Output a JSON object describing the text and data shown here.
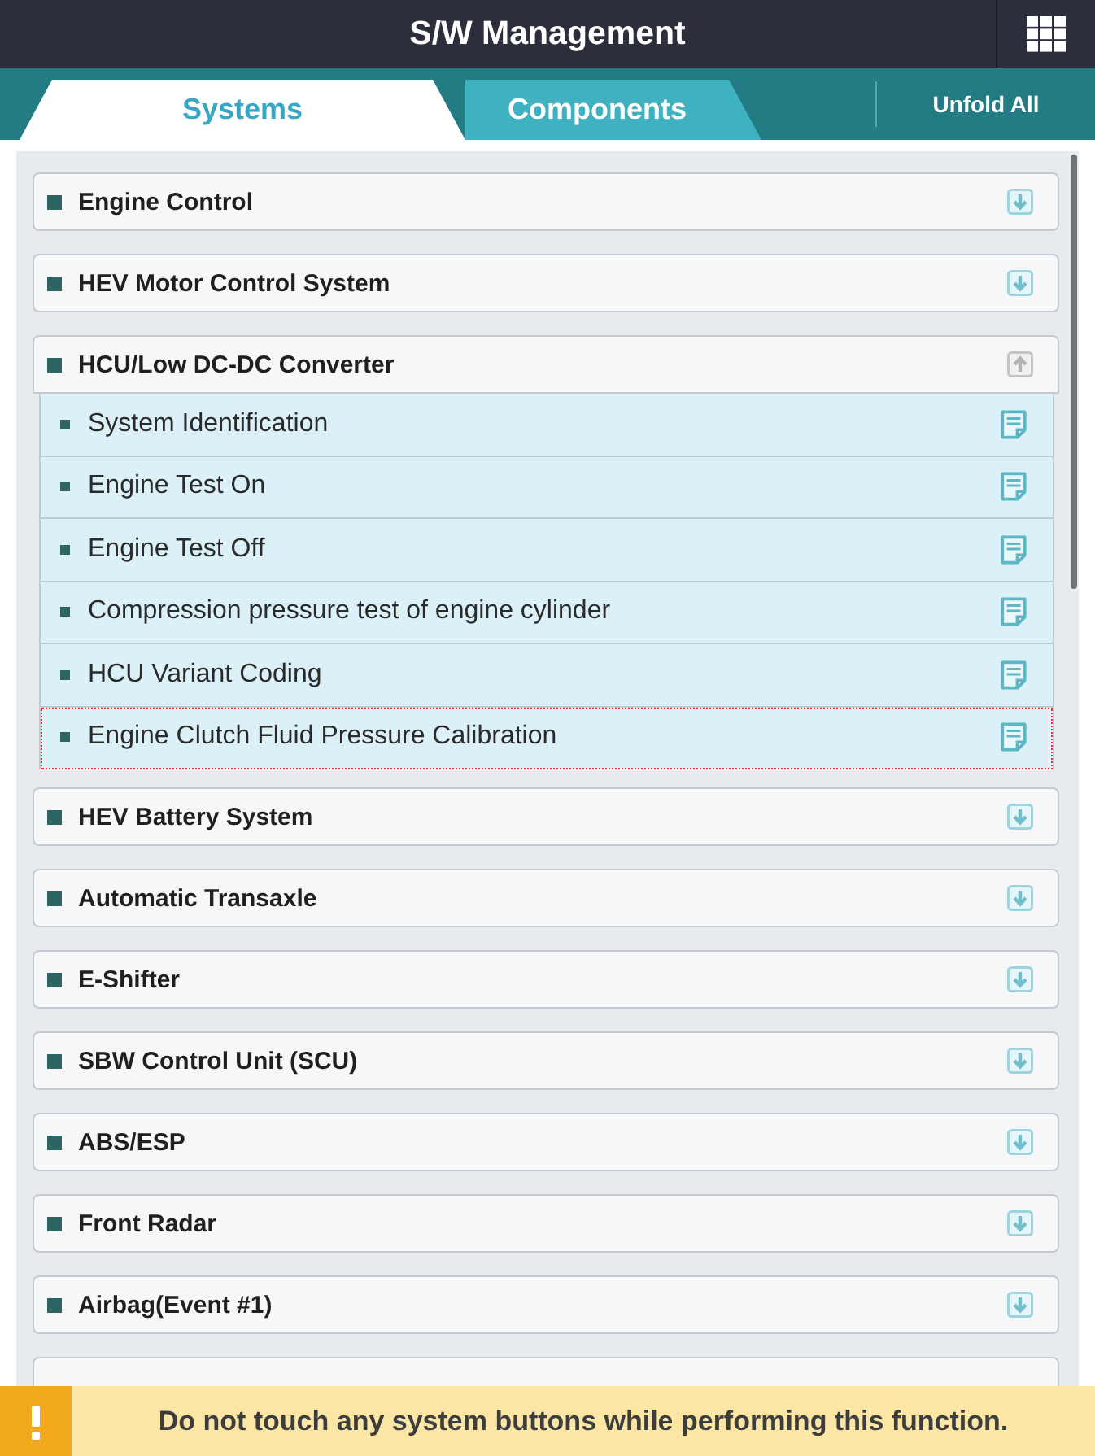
{
  "header": {
    "title": "S/W Management"
  },
  "tabs": [
    {
      "label": "Systems",
      "selected": true
    },
    {
      "label": "Components",
      "selected": false
    }
  ],
  "unfold_all": {
    "label": "Unfold All"
  },
  "systems": [
    {
      "label": "Engine Control",
      "expanded": false
    },
    {
      "label": "HEV Motor Control System",
      "expanded": false
    },
    {
      "label": "HCU/Low DC-DC Converter",
      "expanded": true,
      "children": [
        {
          "label": "System Identification",
          "selected": false
        },
        {
          "label": "Engine Test On",
          "selected": false
        },
        {
          "label": "Engine Test Off",
          "selected": false
        },
        {
          "label": "Compression pressure test of engine cylinder",
          "selected": false
        },
        {
          "label": "HCU Variant Coding",
          "selected": false
        },
        {
          "label": "Engine Clutch Fluid Pressure Calibration",
          "selected": true
        }
      ]
    },
    {
      "label": "HEV Battery System",
      "expanded": false
    },
    {
      "label": "Automatic Transaxle",
      "expanded": false
    },
    {
      "label": "E-Shifter",
      "expanded": false
    },
    {
      "label": "SBW Control Unit (SCU)",
      "expanded": false
    },
    {
      "label": "ABS/ESP",
      "expanded": false
    },
    {
      "label": "Front Radar",
      "expanded": false
    },
    {
      "label": "Airbag(Event #1)",
      "expanded": false
    }
  ],
  "warning": {
    "text": "Do not touch any system buttons while performing this function."
  }
}
